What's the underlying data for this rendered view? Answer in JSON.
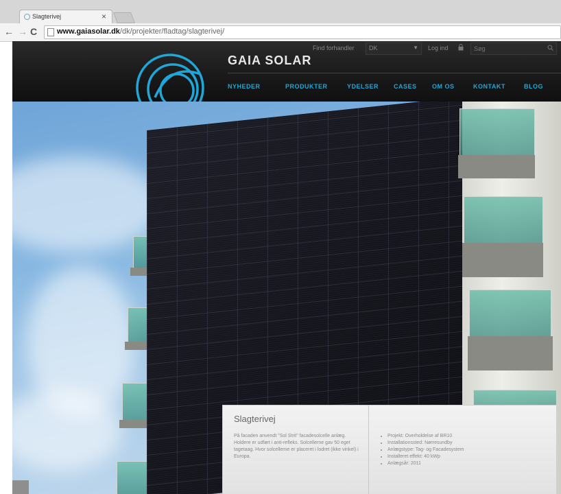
{
  "browser": {
    "tab_title": "Slagterivej",
    "tab_close": "×",
    "url_domain": "www.gaiasolar.dk",
    "url_path": "/dk/projekter/fladtag/slagterivej/"
  },
  "header": {
    "brand": "GAIA SOLAR",
    "brand_sub": "Find forhandler",
    "language": "DK",
    "login": "Log ind",
    "search_placeholder": "Søg",
    "nav": [
      "NYHEDER",
      "PRODUKTER",
      "YDELSER",
      "CASES",
      "OM OS",
      "KONTAKT",
      "BLOG"
    ],
    "accent_color": "#1ea7d7"
  },
  "project": {
    "title": "Slagterivej",
    "description": "På facaden anvendt \"Sol Strit\" facadesolcelle anlæg. Holdere er udført i anti-refleks. Solcellerne gav 50 eget tagetaag. Hvor solcellerne er placeret i lodret (ikke vinkel) i Europa.",
    "facts": [
      "Projekt: Overholdelse af BR10",
      "Installationssted: Nørresundby",
      "Anlægstype: Tag- og Facadesystem",
      "Installeret effekt: 40 kWp",
      "Anlægsår: 2011"
    ]
  }
}
